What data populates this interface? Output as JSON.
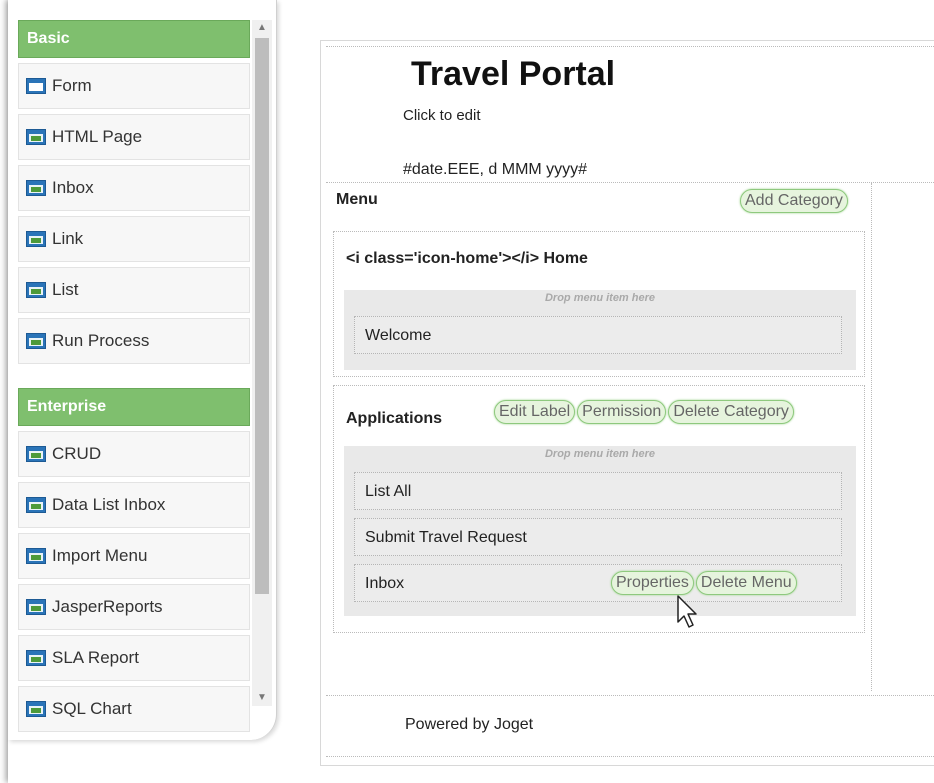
{
  "palette": {
    "categories": [
      {
        "name": "Basic",
        "items": [
          "Form",
          "HTML Page",
          "Inbox",
          "Link",
          "List",
          "Run Process"
        ]
      },
      {
        "name": "Enterprise",
        "items": [
          "CRUD",
          "Data List Inbox",
          "Import Menu",
          "JasperReports",
          "SLA Report",
          "SQL Chart"
        ]
      }
    ]
  },
  "header": {
    "title": "Travel Portal",
    "subtitle": "Click to edit",
    "date_format": "#date.EEE, d MMM yyyy#"
  },
  "menu": {
    "label": "Menu",
    "add_category": "Add Category",
    "drop_hint": "Drop menu item here",
    "categories": [
      {
        "title": "<i class='icon-home'></i> Home",
        "items": [
          "Welcome"
        ]
      },
      {
        "title": "Applications",
        "actions": [
          "Edit Label",
          "Permission",
          "Delete Category"
        ],
        "items": [
          "List All",
          "Submit Travel Request",
          "Inbox"
        ]
      }
    ],
    "item_actions": [
      "Properties",
      "Delete Menu"
    ]
  },
  "footer": {
    "text": "Powered by Joget"
  },
  "colors": {
    "category_header": "#7fbf6e",
    "pill_border": "#8ec97e",
    "pill_bg": "#e6f4dd"
  }
}
